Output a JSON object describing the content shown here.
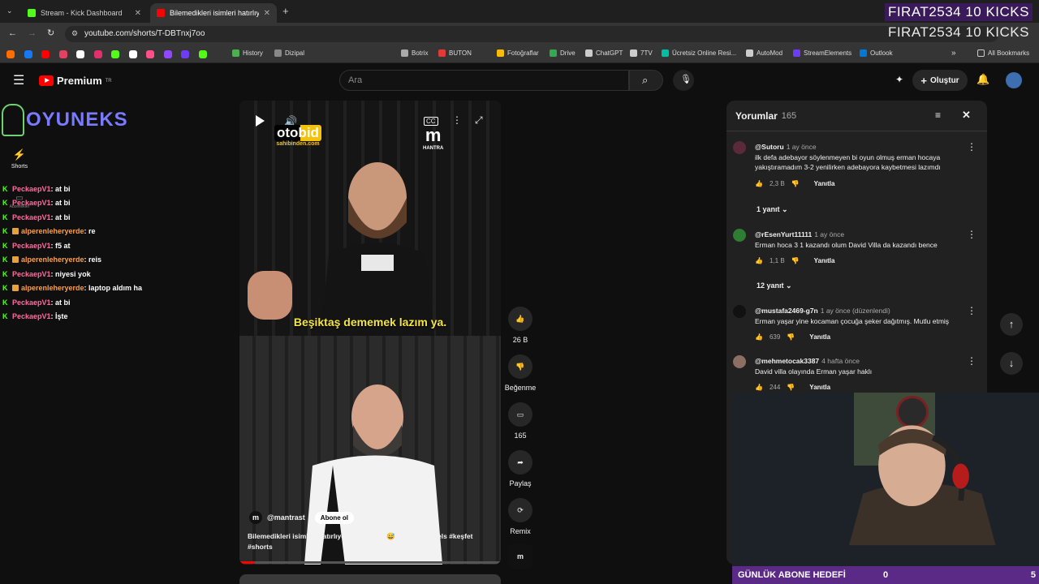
{
  "browser": {
    "tabs": [
      {
        "title": "Stream - Kick Dashboard",
        "active": false,
        "favicon_color": "#53fc18"
      },
      {
        "title": "Bilemedikleri isimleri hatırlıyor mu",
        "active": true,
        "favicon_color": "#ff0000"
      }
    ],
    "new_tab": "+",
    "url": "youtube.com/shorts/T-DBTnxj7oo",
    "bookmarks": [
      {
        "label": "History",
        "color": "#4caf50"
      },
      {
        "label": "Dizipal",
        "color": "#888888"
      },
      {
        "label": "Botrix",
        "color": "#aaaaaa"
      },
      {
        "label": "BUTON",
        "color": "#e53935"
      },
      {
        "label": "Fotoğraflar",
        "color": "#fbbc04"
      },
      {
        "label": "Drive",
        "color": "#34a853"
      },
      {
        "label": "ChatGPT",
        "color": "#cccccc"
      },
      {
        "label": "7TV",
        "color": "#cccccc"
      },
      {
        "label": "Ücretsiz Online Resi...",
        "color": "#00bfa5"
      },
      {
        "label": "AutoMod",
        "color": "#cccccc"
      },
      {
        "label": "StreamElements",
        "color": "#6f3cf5"
      },
      {
        "label": "Outlook",
        "color": "#0078d4"
      }
    ],
    "all_bookmarks": "All Bookmarks"
  },
  "overlay": {
    "kicks_line1": "FIRAT2534  10 KICKS",
    "kicks_line2": "FIRAT2534  10 KICKS",
    "brand": "OYUNEKS",
    "goal_label": "GÜNLÜK ABONE HEDEFİ",
    "goal_current": "0",
    "goal_target": "5"
  },
  "youtube": {
    "logo_text": "Premium",
    "logo_region": "TR",
    "search_placeholder": "Ara",
    "create_label": "Oluştur",
    "nav_shorts": "Shorts",
    "nav_subs": "Abonelikler"
  },
  "chat": [
    {
      "user": "PeckaepV1",
      "user_color": "#ff6b9d",
      "badge": false,
      "msg": ": at bi"
    },
    {
      "user": "PeckaepV1",
      "user_color": "#ff6b9d",
      "badge": false,
      "msg": ": at bi"
    },
    {
      "user": "PeckaepV1",
      "user_color": "#ff6b9d",
      "badge": false,
      "msg": ": at bi"
    },
    {
      "user": "alperenleheryerde",
      "user_color": "#ff9f43",
      "badge": true,
      "msg": ": re"
    },
    {
      "user": "PeckaepV1",
      "user_color": "#ff6b9d",
      "badge": false,
      "msg": ": f5 at"
    },
    {
      "user": "alperenleheryerde",
      "user_color": "#ff9f43",
      "badge": true,
      "msg": ": reis"
    },
    {
      "user": "PeckaepV1",
      "user_color": "#ff6b9d",
      "badge": false,
      "msg": ": niyesi yok"
    },
    {
      "user": "alperenleheryerde",
      "user_color": "#ff9f43",
      "badge": true,
      "msg": ": laptop aldım ha"
    },
    {
      "user": "PeckaepV1",
      "user_color": "#ff6b9d",
      "badge": false,
      "msg": ": at bi"
    },
    {
      "user": "PeckaepV1",
      "user_color": "#ff6b9d",
      "badge": false,
      "msg": ": İşte"
    }
  ],
  "video": {
    "sponsor": "otobid",
    "sponsor_sub": "sahibinden.com",
    "channel_logo": "HANTRA",
    "subtitle": "Beşiktaş dememek lazım ya.",
    "channel": "@mantrast",
    "subscribe": "Abone ol",
    "caption": "Bilemedikleri isimleri hatırlıyor musunuz? 😅 #işbirliği #reels #keşfet #shorts",
    "cc": "CC"
  },
  "actions": {
    "like_count": "26 B",
    "dislike_label": "Beğenme",
    "comment_count": "165",
    "share_label": "Paylaş",
    "remix_label": "Remix"
  },
  "comments": {
    "title": "Yorumlar",
    "count": "165",
    "items": [
      {
        "user": "@Sutoru",
        "time": "1 ay önce",
        "text": "ilk defa adebayor söylenmeyen bi oyun olmuş erman hocaya yakıştıramadım 3-2 yenilirken adebayora kaybetmesi lazımdı",
        "likes": "2,3 B",
        "reply": "Yanıtla",
        "avatar_color": "#5a2a3a"
      },
      {
        "user": "@rEsenYurt11111",
        "time": "1 ay önce",
        "text": "Erman hoca 3 1 kazandı olum David Villa da kazandı bence",
        "likes": "1,1 B",
        "reply": "Yanıtla",
        "avatar_color": "#2e7d32"
      },
      {
        "user": "@mustafa2469-g7n",
        "time": "1 ay önce (düzenlendi)",
        "text": "Erman yaşar yine kocaman çocuğa şeker dağıtmış. Mutlu etmiş",
        "likes": "639",
        "reply": "Yanıtla",
        "avatar_color": "#111111"
      },
      {
        "user": "@mehmetocak3387",
        "time": "4 hafta önce",
        "text": "David villa olayında Erman yaşar haklı",
        "likes": "244",
        "reply": "Yanıtla",
        "avatar_color": "#8d6e63"
      }
    ],
    "replies": [
      "1 yanıt",
      "12 yanıt"
    ]
  }
}
